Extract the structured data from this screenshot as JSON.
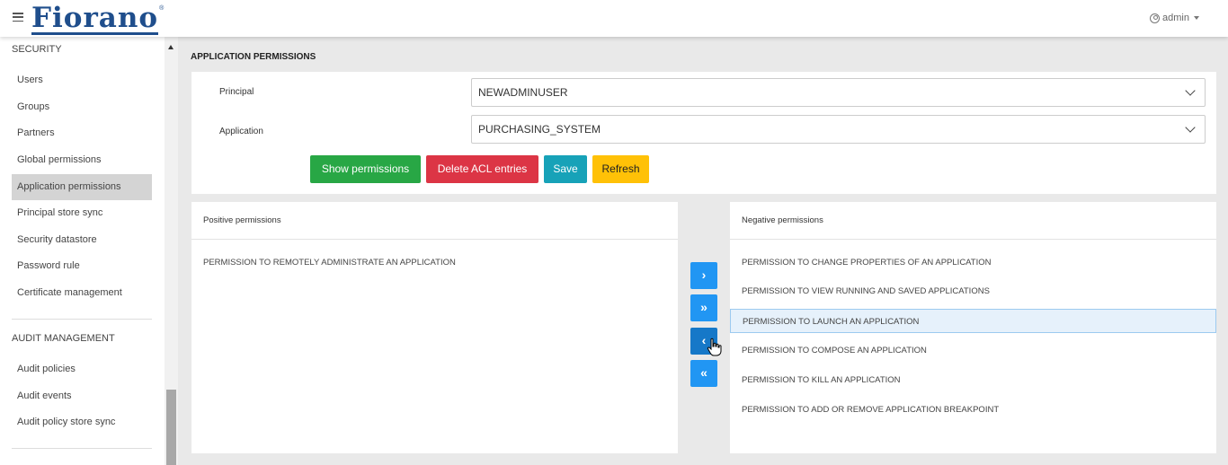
{
  "header": {
    "logo": "Fiorano",
    "logo_mark": "®",
    "user": "admin"
  },
  "sidebar": {
    "sections": [
      {
        "title": "SECURITY",
        "items": [
          {
            "label": "Users"
          },
          {
            "label": "Groups"
          },
          {
            "label": "Partners"
          },
          {
            "label": "Global permissions"
          },
          {
            "label": "Application permissions",
            "active": true
          },
          {
            "label": "Principal store sync"
          },
          {
            "label": "Security datastore"
          },
          {
            "label": "Password rule"
          },
          {
            "label": "Certificate management"
          }
        ]
      },
      {
        "title": "AUDIT MANAGEMENT",
        "items": [
          {
            "label": "Audit policies"
          },
          {
            "label": "Audit events"
          },
          {
            "label": "Audit policy store sync"
          }
        ]
      }
    ]
  },
  "page": {
    "title": "APPLICATION PERMISSIONS"
  },
  "form": {
    "principal_label": "Principal",
    "principal_value": "NEWADMINUSER",
    "application_label": "Application",
    "application_value": "PURCHASING_SYSTEM",
    "buttons": {
      "show": "Show permissions",
      "delete": "Delete ACL entries",
      "save": "Save",
      "refresh": "Refresh"
    }
  },
  "positive": {
    "title": "Positive permissions",
    "items": [
      "PERMISSION TO REMOTELY ADMINISTRATE AN APPLICATION"
    ]
  },
  "negative": {
    "title": "Negative permissions",
    "items": [
      "PERMISSION TO CHANGE PROPERTIES OF AN APPLICATION",
      "PERMISSION TO VIEW RUNNING AND SAVED APPLICATIONS",
      "PERMISSION TO LAUNCH AN APPLICATION",
      "PERMISSION TO COMPOSE AN APPLICATION",
      "PERMISSION TO KILL AN APPLICATION",
      "PERMISSION TO ADD OR REMOVE APPLICATION BREAKPOINT"
    ],
    "selected_index": 2
  },
  "transfer": {
    "move_right": "›",
    "move_all_right": "»",
    "move_left": "‹",
    "move_all_left": "«"
  },
  "colors": {
    "brand": "#1f4e8c",
    "green": "#28a745",
    "red": "#dc3545",
    "teal": "#17a2b8",
    "yellow": "#ffc107",
    "blue": "#2196f3"
  }
}
